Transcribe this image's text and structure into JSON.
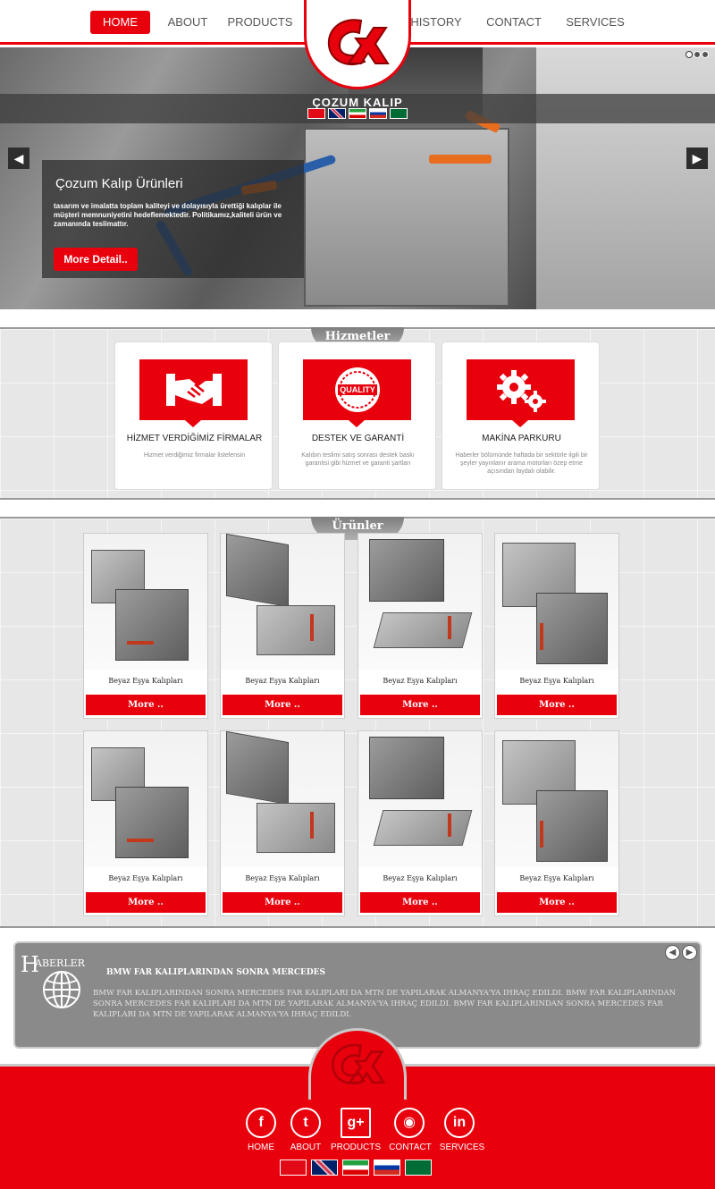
{
  "nav": {
    "items": [
      {
        "label": "HOME",
        "active": true
      },
      {
        "label": "ABOUT",
        "active": false
      },
      {
        "label": "PRODUCTS",
        "active": false
      },
      {
        "label": "HISTORY",
        "active": false
      },
      {
        "label": "CONTACT",
        "active": false
      },
      {
        "label": "SERVICES",
        "active": false
      }
    ]
  },
  "brand": {
    "name": "ÇOZUM KALIP",
    "accent": "#e8000d"
  },
  "slider": {
    "caption_title": "Çozum Kalıp Ürünleri",
    "caption_text": "tasarım ve imalatta toplam kaliteyi ve dolayısıyla ürettiği kalıplar ile müşteri memnuniyetini hedeflemektedir. Politikamız,kaliteli ürün ve zamanında teslimattır.",
    "button": "More Detail..",
    "prev_icon": "◀",
    "next_icon": "▶"
  },
  "services": {
    "title": "Hizmetler",
    "items": [
      {
        "title": "HİZMET VERDİĞİMİZ FİRMALAR",
        "text": "Hizmet verdiğimiz firmalar listelensin",
        "icon": "handshake-icon"
      },
      {
        "title": "DESTEK VE GARANTİ",
        "text": "Kalıbın teslimi satış sonrası destek baskı garantisi gibi hizmet ve garanti şartları",
        "icon": "quality-badge-icon"
      },
      {
        "title": "MAKİNA PARKURU",
        "text": "Haberler bölümünde haftada bir sektörle ilgili bir şeyler yayınlanır arama motorları özep etme açısından faydalı olabilir.",
        "icon": "gears-icon"
      }
    ]
  },
  "products": {
    "title": "Ürünler",
    "items": [
      {
        "name": "Beyaz Eşya Kalıpları",
        "more": "More .."
      },
      {
        "name": "Beyaz Eşya Kalıpları",
        "more": "More .."
      },
      {
        "name": "Beyaz Eşya Kalıpları",
        "more": "More .."
      },
      {
        "name": "Beyaz Eşya Kalıpları",
        "more": "More .."
      },
      {
        "name": "Beyaz Eşya Kalıpları",
        "more": "More .."
      },
      {
        "name": "Beyaz Eşya Kalıpları",
        "more": "More .."
      },
      {
        "name": "Beyaz Eşya Kalıpları",
        "more": "More .."
      },
      {
        "name": "Beyaz Eşya Kalıpları",
        "more": "More .."
      }
    ]
  },
  "news": {
    "heading_initial": "H",
    "heading_rest": "ABERLER",
    "title": "BMW FAR KALIPLARINDAN SONRA MERCEDES",
    "body": "BMW FAR KALIPLARINDAN SONRA MERCEDES FAR KALIPLARI DA MTN DE YAPILARAK ALMANYA'YA IHRAÇ EDILDI.  BMW FAR KALIPLARINDAN SONRA MERCEDES FAR KALIPLARI DA MTN DE YAPILARAK ALMANYA'YA IHRAÇ EDILDI.  BMW FAR KALIPLARINDAN SONRA MERCEDES FAR KALIPLARI DA MTN DE YAPILARAK ALMANYA'YA IHRAÇ EDILDI."
  },
  "footer": {
    "links": [
      {
        "label": "HOME",
        "icon": "facebook-icon",
        "glyph": "f"
      },
      {
        "label": "ABOUT",
        "icon": "twitter-icon",
        "glyph": "t"
      },
      {
        "label": "PRODUCTS",
        "icon": "google-plus-icon",
        "glyph": "g+"
      },
      {
        "label": "CONTACT",
        "icon": "rss-icon",
        "glyph": "◉"
      },
      {
        "label": "SERVICES",
        "icon": "linkedin-icon",
        "glyph": "in"
      }
    ],
    "languages": [
      "tr",
      "en",
      "ir",
      "ru",
      "sa"
    ]
  }
}
